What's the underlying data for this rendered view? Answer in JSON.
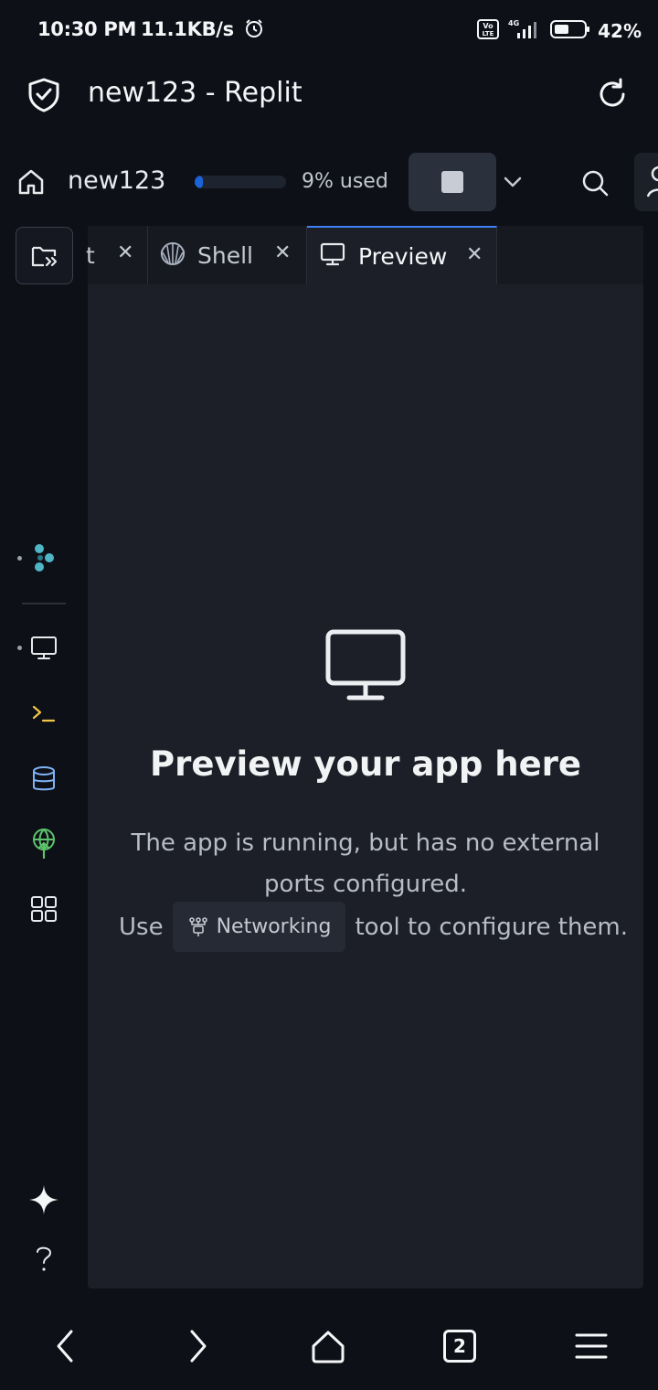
{
  "status_bar": {
    "time": "10:30 PM",
    "speed": "11.1KB/s",
    "battery": "42%",
    "network": "4G",
    "volte": "Vo LTE"
  },
  "browser": {
    "title": "new123 - Replit"
  },
  "header": {
    "project_name": "new123",
    "usage_fraction": 0.09,
    "usage_text": "9% used"
  },
  "tabs": [
    {
      "label": "t",
      "icon": "file-icon"
    },
    {
      "label": "Shell",
      "icon": "shell-icon"
    },
    {
      "label": "Preview",
      "icon": "monitor-icon",
      "active": true
    }
  ],
  "preview": {
    "title": "Preview your app here",
    "description": "The app is running, but has no external ports configured.",
    "use_prefix": "Use",
    "networking_label": "Networking",
    "use_suffix": "tool to configure them."
  },
  "bottom_nav": {
    "tab_count": "2"
  },
  "colors": {
    "background": "#0e1017",
    "panel": "#1c1f27",
    "accent": "#3d82f5",
    "terminal_yellow": "#f0c64a",
    "database_blue": "#7fb3f5",
    "deploy_green": "#5cc46b",
    "agent_teal": "#4fb6c8"
  }
}
